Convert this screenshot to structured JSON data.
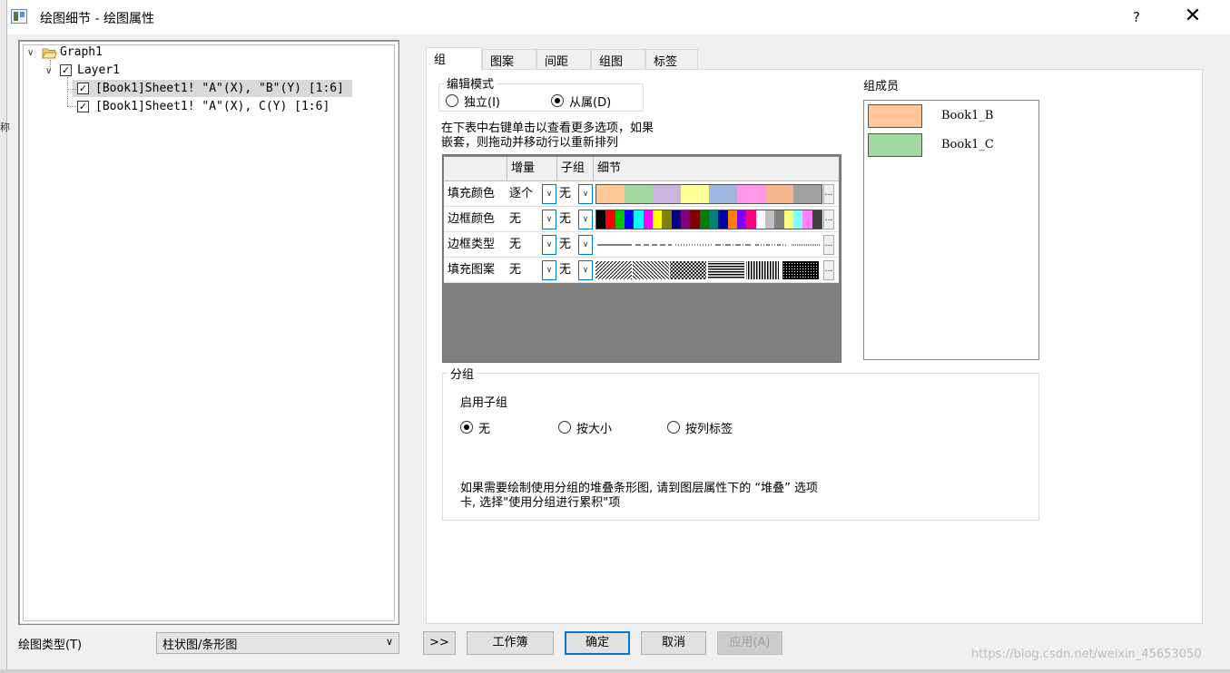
{
  "window": {
    "title": "绘图细节 - 绘图属性",
    "help_label": "?",
    "close_label": "✕",
    "left_edge_text": "称"
  },
  "tree": {
    "root": "Graph1",
    "layer": "Layer1",
    "items": [
      "[Book1]Sheet1! \"A\"(X), \"B\"(Y) [1:6]",
      "[Book1]Sheet1! \"A\"(X), C(Y) [1:6]"
    ]
  },
  "plot_type": {
    "label": "绘图类型(T)",
    "value": "柱状图/条形图"
  },
  "buttons": {
    "expand": ">>",
    "workbook": "工作簿",
    "ok": "确定",
    "cancel": "取消",
    "apply": "应用(A)"
  },
  "tabs": [
    "组",
    "图案",
    "间距",
    "组图",
    "标签"
  ],
  "edit_mode": {
    "title": "编辑模式",
    "options": [
      "独立(I)",
      "从属(D)"
    ],
    "selected": 1
  },
  "instructions": [
    "在下表中右键单击以查看更多选项，如果",
    "嵌套，则拖动并移动行以重新排列"
  ],
  "grid": {
    "headers": [
      "",
      "增量",
      "子组",
      "细节"
    ],
    "rows": [
      {
        "name": "填充颜色",
        "increment": "逐个",
        "subgroup": "无",
        "ellipsis": "..."
      },
      {
        "name": "边框颜色",
        "increment": "无",
        "subgroup": "无",
        "ellipsis": "..."
      },
      {
        "name": "边框类型",
        "increment": "无",
        "subgroup": "无",
        "ellipsis": "..."
      },
      {
        "name": "填充图案",
        "increment": "无",
        "subgroup": "无",
        "ellipsis": "..."
      }
    ],
    "fill_colors": [
      "#ffc896",
      "#a0d8a0",
      "#c8b4dc",
      "#ffff96",
      "#a0b8e0",
      "#ff96e6",
      "#f5b48c",
      "#a0a0a0"
    ],
    "border_colors": [
      "#000000",
      "#ff0000",
      "#00c800",
      "#0000ff",
      "#00ffff",
      "#ff00ff",
      "#ffff00",
      "#808000",
      "#000080",
      "#800080",
      "#800000",
      "#008000",
      "#008080",
      "#0000a0",
      "#ff8000",
      "#8000ff",
      "#ff0080",
      "#ffffff",
      "#c0c0c0",
      "#808080",
      "#ffff80",
      "#80ffff",
      "#ff80ff",
      "#404040"
    ]
  },
  "group_members": {
    "title": "组成员",
    "items": [
      {
        "name": "Book1_B",
        "color": "#ffc896"
      },
      {
        "name": "Book1_C",
        "color": "#a0d8a0"
      }
    ]
  },
  "grouping": {
    "title": "分组",
    "subtitle": "启用子组",
    "options": [
      "无",
      "按大小",
      "按列标签"
    ],
    "selected": 0,
    "note": [
      "如果需要绘制使用分组的堆叠条形图, 请到图层属性下的 “堆叠” 选项",
      "卡, 选择\"使用分组进行累积\"项"
    ]
  },
  "watermark": "https://blog.csdn.net/weixin_45653050"
}
